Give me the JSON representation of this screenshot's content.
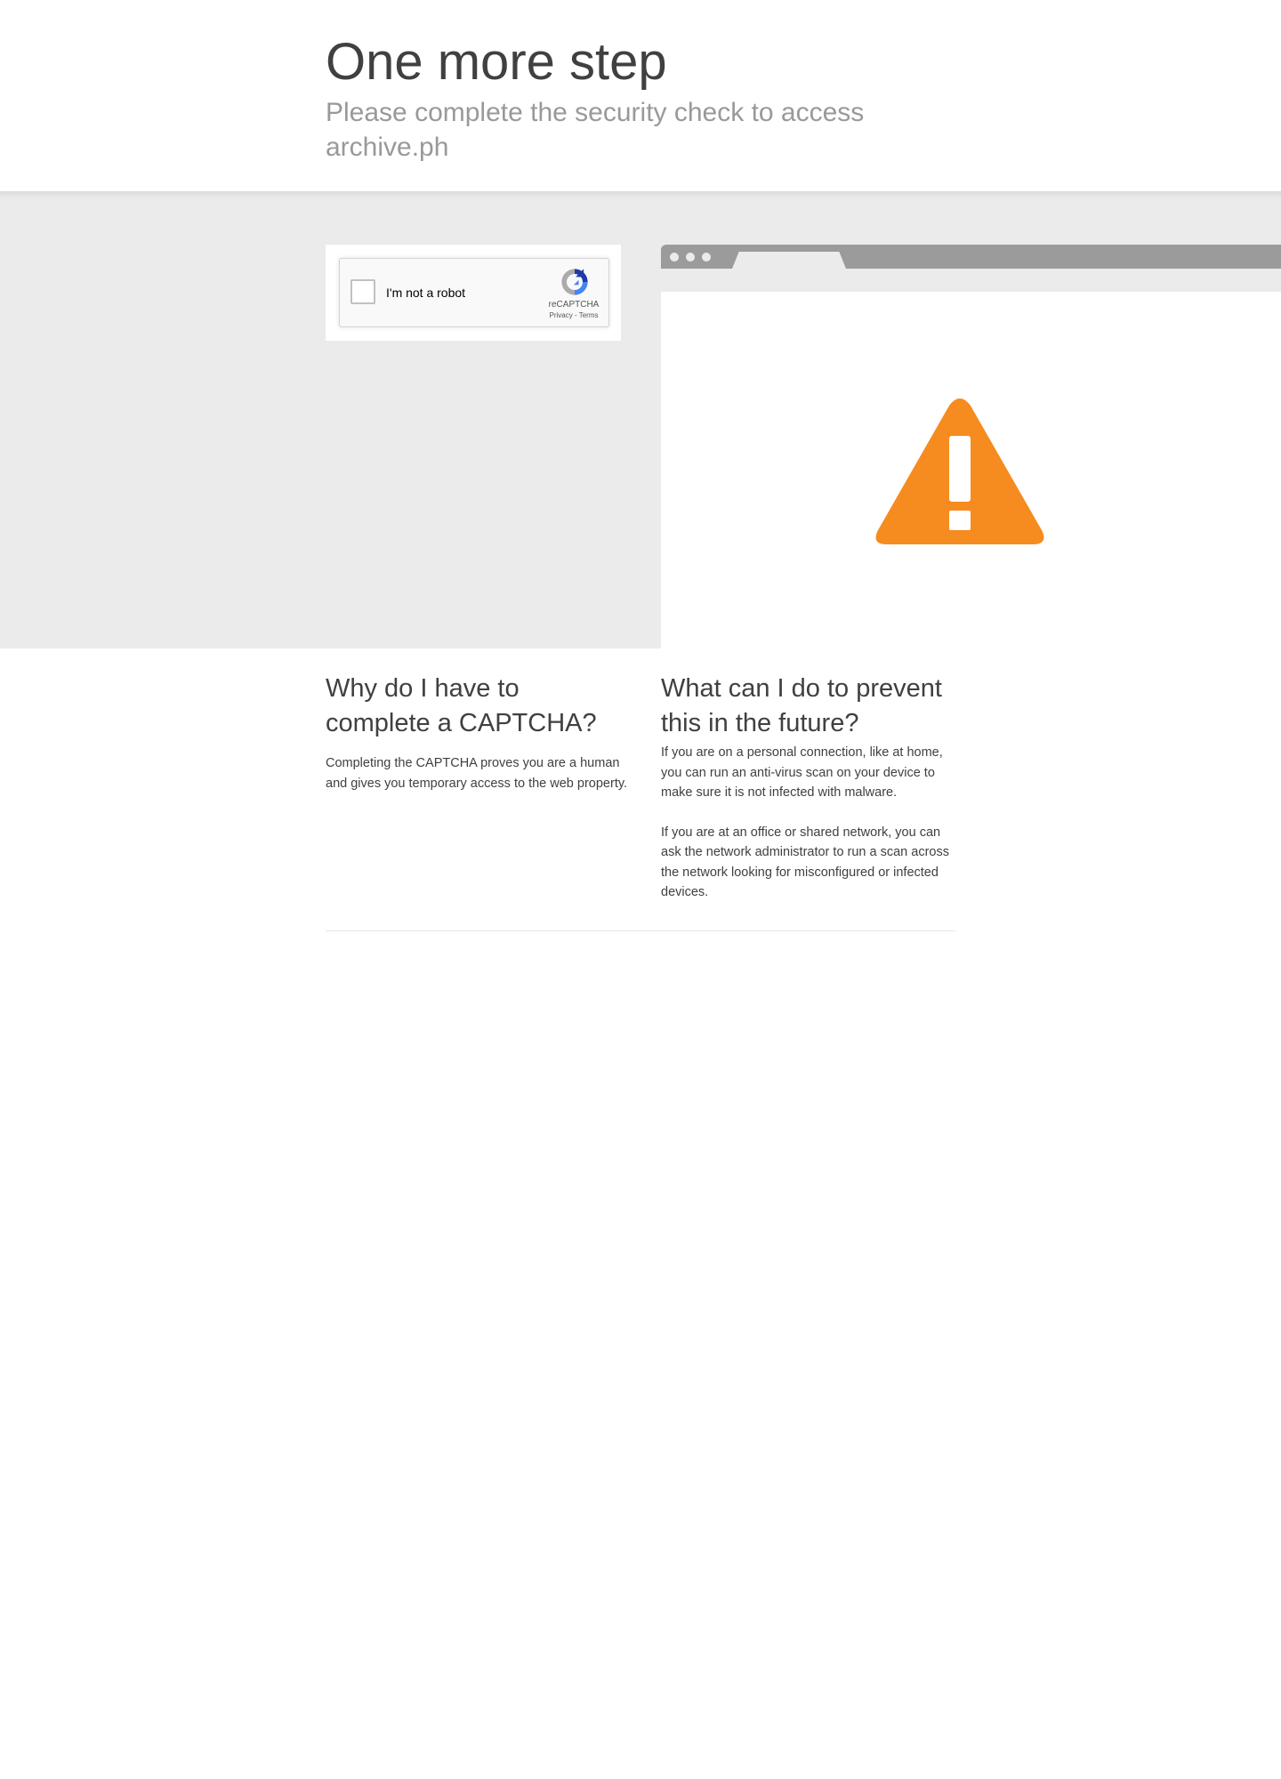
{
  "header": {
    "title": "One more step",
    "subtitle": "Please complete the security check to access archive.ph"
  },
  "recaptcha": {
    "checkbox_label": "I'm not a robot",
    "brand": "reCAPTCHA",
    "privacy_link": "Privacy",
    "separator": " - ",
    "terms_link": "Terms",
    "checked": false
  },
  "illustration": {
    "icon": "warning-triangle-icon",
    "icon_color": "#f68b1f",
    "browser_chrome_color": "#9b9b9b"
  },
  "why": {
    "heading": "Why do I have to complete a CAPTCHA?",
    "body": "Completing the CAPTCHA proves you are a human and gives you temporary access to the web property."
  },
  "prevent": {
    "heading": "What can I do to prevent this in the future?",
    "body_personal": "If you are on a personal connection, like at home, you can run an anti-virus scan on your device to make sure it is not infected with malware.",
    "body_office": "If you are at an office or shared network, you can ask the network administrator to run a scan across the network looking for misconfigured or infected devices."
  }
}
